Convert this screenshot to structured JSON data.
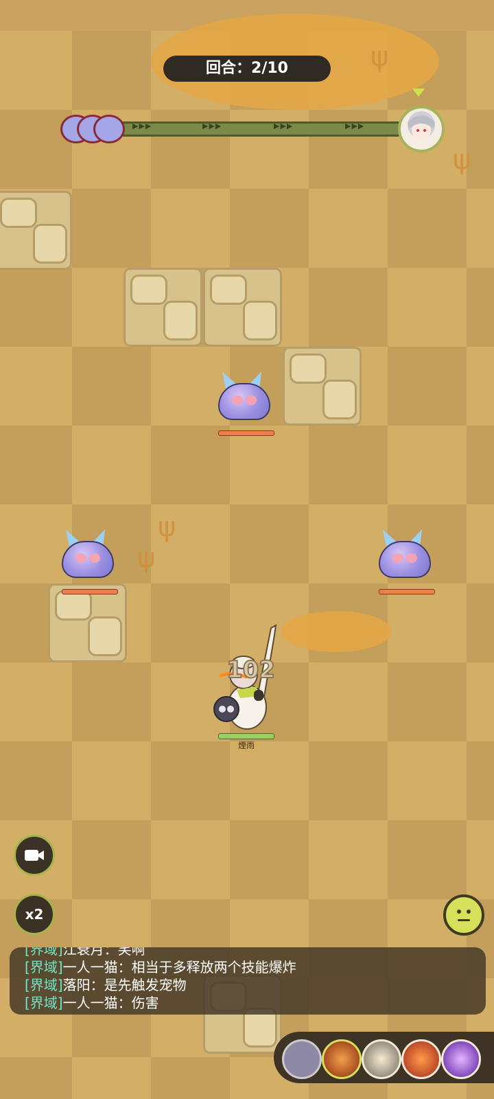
{
  "hud": {
    "round_label": "回合：2/10"
  },
  "progress": {
    "arrow_text": "▶▶▶"
  },
  "hero": {
    "name": "煙雨",
    "damage_number": "102"
  },
  "buttons": {
    "speed_label": "x2"
  },
  "chat": {
    "lines": [
      {
        "channel": "[界域]",
        "text": "江衰月：笑啊"
      },
      {
        "channel": "[界域]",
        "text": "一人一猫：相当于多释放两个技能爆炸"
      },
      {
        "channel": "[界域]",
        "text": "落阳：是先触发宠物"
      },
      {
        "channel": "[界域]",
        "text": "一人一猫：伤害"
      }
    ]
  },
  "colors": {
    "tile_light": "#d3ae67",
    "tile_dark": "#c49f5b",
    "chat_channel": "#6fe7c7",
    "accent_green": "#a7b34b"
  },
  "icons": {
    "camera": "camera-icon",
    "emoji": "neutral-face-icon"
  }
}
